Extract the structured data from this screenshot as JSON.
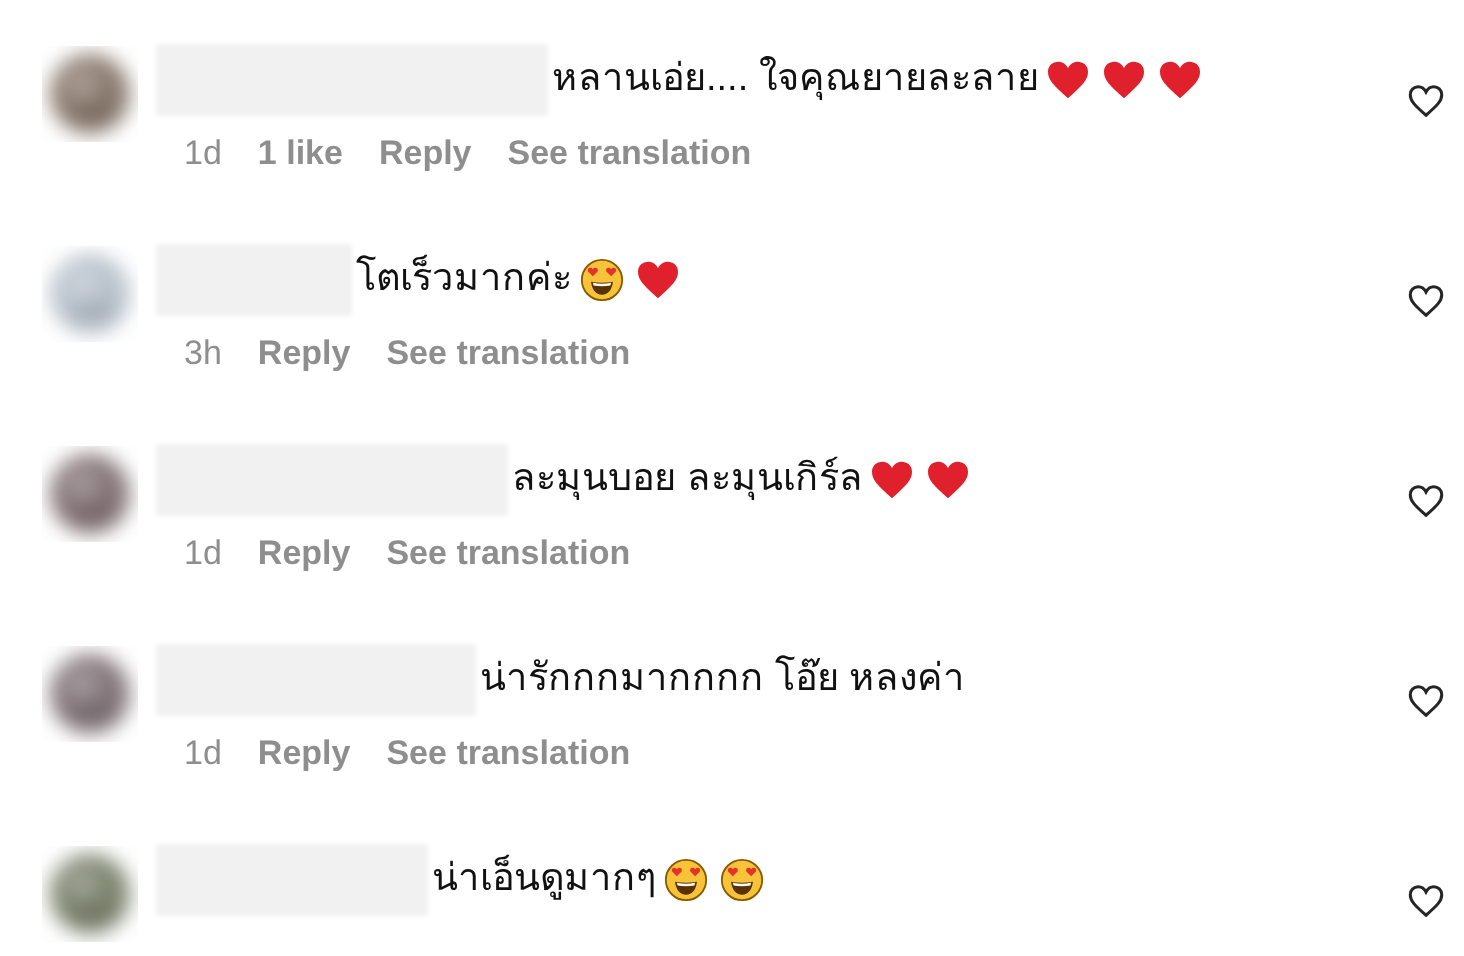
{
  "comments": [
    {
      "text": "หลานเอ่ย.... ใจคุณยายละลาย",
      "emojis": [
        {
          "kind": "heart"
        },
        {
          "kind": "heart"
        },
        {
          "kind": "heart"
        }
      ],
      "meta": [
        {
          "kind": "time",
          "text": "1d"
        },
        {
          "kind": "likes",
          "text": "1 like"
        },
        {
          "kind": "action",
          "text": "Reply"
        },
        {
          "kind": "action",
          "text": "See translation"
        }
      ]
    },
    {
      "text": "โตเร็วมากค่ะ",
      "emojis": [
        {
          "kind": "heart_eyes"
        },
        {
          "kind": "heart"
        }
      ],
      "meta": [
        {
          "kind": "time",
          "text": "3h"
        },
        {
          "kind": "action",
          "text": "Reply"
        },
        {
          "kind": "action",
          "text": "See translation"
        }
      ]
    },
    {
      "text": "ละมุนบอย ละมุนเกิร์ล",
      "emojis": [
        {
          "kind": "heart"
        },
        {
          "kind": "heart"
        }
      ],
      "meta": [
        {
          "kind": "time",
          "text": "1d"
        },
        {
          "kind": "action",
          "text": "Reply"
        },
        {
          "kind": "action",
          "text": "See translation"
        }
      ]
    },
    {
      "text": "น่ารักกกมากกกก โอ๊ย หลงค่า",
      "meta": [
        {
          "kind": "time",
          "text": "1d"
        },
        {
          "kind": "action",
          "text": "Reply"
        },
        {
          "kind": "action",
          "text": "See translation"
        }
      ]
    },
    {
      "text": "น่าเอ็นดูมากๆ",
      "emojis": [
        {
          "kind": "heart_eyes"
        },
        {
          "kind": "heart_eyes"
        }
      ]
    }
  ]
}
